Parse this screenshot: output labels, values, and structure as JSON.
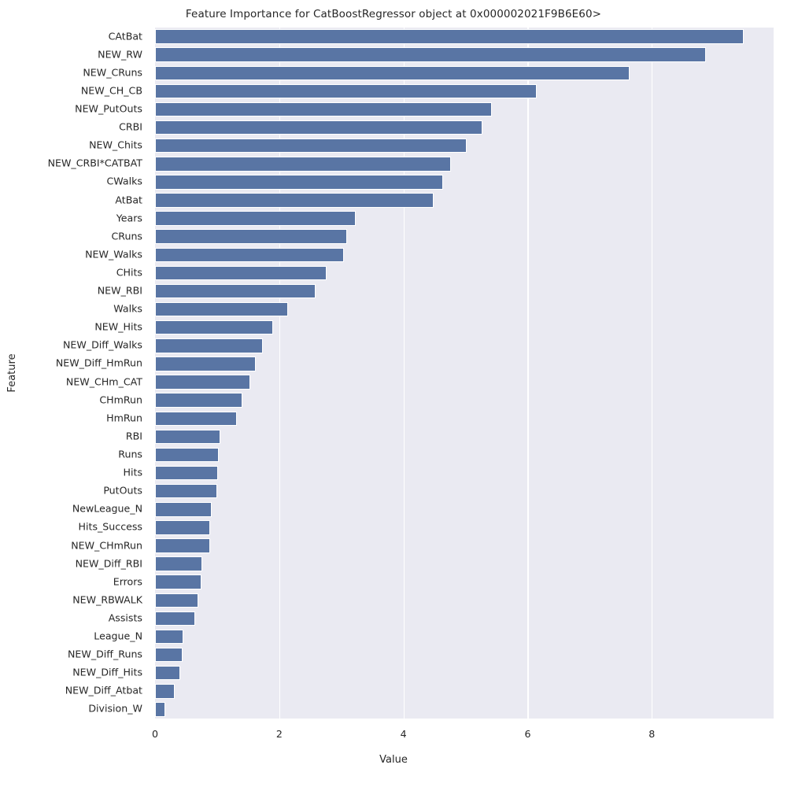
{
  "chart_data": {
    "type": "bar",
    "orientation": "horizontal",
    "title": "Feature Importance for CatBoostRegressor object at 0x000002021F9B6E60>",
    "xlabel": "Value",
    "ylabel": "Feature",
    "xlim": [
      0,
      9.96
    ],
    "xticks": [
      0,
      2,
      4,
      6,
      8
    ],
    "xtick_labels": [
      "0",
      "2",
      "4",
      "6",
      "8"
    ],
    "grid": true,
    "legend": "none",
    "bar_color": "#5975a4",
    "plot_background": "#eaeaf2",
    "figure_background": "#ffffff",
    "grid_color": "#ffffff",
    "categories": [
      "CAtBat",
      "NEW_RW",
      "NEW_CRuns",
      "NEW_CH_CB",
      "NEW_PutOuts",
      "CRBI",
      "NEW_Chits",
      "NEW_CRBI*CATBAT",
      "CWalks",
      "AtBat",
      "Years",
      "CRuns",
      "NEW_Walks",
      "CHits",
      "NEW_RBI",
      "Walks",
      "NEW_Hits",
      "NEW_Diff_Walks",
      "NEW_Diff_HmRun",
      "NEW_CHm_CAT",
      "CHmRun",
      "HmRun",
      "RBI",
      "Runs",
      "Hits",
      "PutOuts",
      "NewLeague_N",
      "Hits_Success",
      "NEW_CHmRun",
      "NEW_Diff_RBI",
      "Errors",
      "NEW_RBWALK",
      "Assists",
      "League_N",
      "NEW_Diff_Runs",
      "NEW_Diff_Hits",
      "NEW_Diff_Atbat",
      "Division_W"
    ],
    "values": [
      9.48,
      8.87,
      7.64,
      6.15,
      5.42,
      5.27,
      5.02,
      4.77,
      4.64,
      4.49,
      3.23,
      3.09,
      3.04,
      2.76,
      2.58,
      2.14,
      1.9,
      1.73,
      1.62,
      1.53,
      1.41,
      1.32,
      1.05,
      1.03,
      1.02,
      1.0,
      0.91,
      0.89,
      0.89,
      0.76,
      0.75,
      0.7,
      0.65,
      0.45,
      0.44,
      0.4,
      0.32,
      0.17
    ]
  }
}
